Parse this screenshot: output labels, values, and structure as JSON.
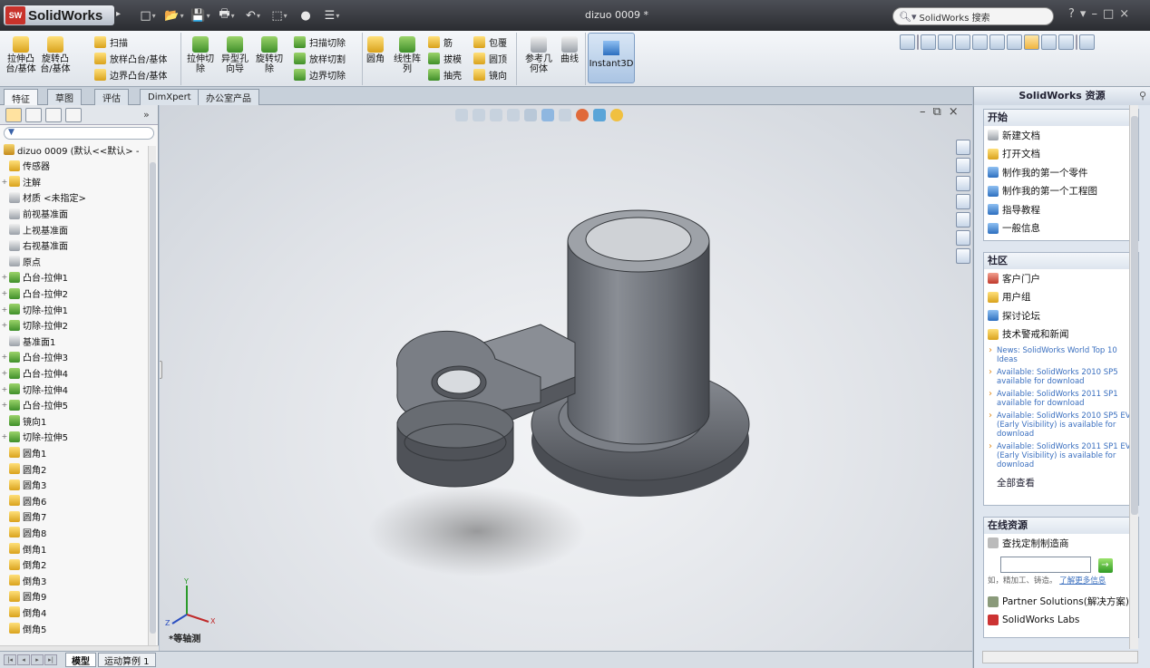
{
  "app": {
    "logo_text": "SolidWorks",
    "logo_badge": "SW",
    "doc_title": "dizuo 0009 *"
  },
  "titlebar": {
    "search_placeholder": "SolidWorks 搜索",
    "help": "?",
    "minimize": "–",
    "maximize": "□",
    "close": "×"
  },
  "ribbon": {
    "extrude_boss": "拉伸凸\n台/基体",
    "revolve_boss": "旋转凸\n台/基体",
    "sweep": "扫描",
    "loft": "放样凸台/基体",
    "boundary_boss": "边界凸台/基体",
    "extrude_cut": "拉伸切\n除",
    "hole_wizard": "异型孔\n向导",
    "revolve_cut": "旋转切\n除",
    "sweep_cut": "扫描切除",
    "loft_cut": "放样切割",
    "boundary_cut": "边界切除",
    "fillet": "圆角",
    "linear_pattern": "线性阵\n列",
    "rib": "筋",
    "draft": "拔模",
    "shell": "抽壳",
    "wrap": "包覆",
    "dome": "圆顶",
    "mirror": "镜向",
    "ref_geometry": "参考几\n何体",
    "curves": "曲线",
    "instant3d": "Instant3D"
  },
  "tabs": [
    "特征",
    "草图",
    "评估",
    "DimXpert",
    "办公室产品"
  ],
  "feature_tree": {
    "root": "dizuo 0009  (默认<<默认> -",
    "items": [
      {
        "label": "传感器",
        "toggle": "",
        "color": "y"
      },
      {
        "label": "注解",
        "toggle": "+",
        "color": "y"
      },
      {
        "label": "材质 <未指定>",
        "toggle": "",
        "color": "gy"
      },
      {
        "label": "前视基准面",
        "toggle": "",
        "color": "gy"
      },
      {
        "label": "上视基准面",
        "toggle": "",
        "color": "gy"
      },
      {
        "label": "右视基准面",
        "toggle": "",
        "color": "gy"
      },
      {
        "label": "原点",
        "toggle": "",
        "color": "gy"
      },
      {
        "label": "凸台-拉伸1",
        "toggle": "+",
        "color": "g"
      },
      {
        "label": "凸台-拉伸2",
        "toggle": "+",
        "color": "g"
      },
      {
        "label": "切除-拉伸1",
        "toggle": "+",
        "color": "g"
      },
      {
        "label": "切除-拉伸2",
        "toggle": "+",
        "color": "g"
      },
      {
        "label": "基准面1",
        "toggle": "",
        "color": "gy"
      },
      {
        "label": "凸台-拉伸3",
        "toggle": "+",
        "color": "g"
      },
      {
        "label": "凸台-拉伸4",
        "toggle": "+",
        "color": "g"
      },
      {
        "label": "切除-拉伸4",
        "toggle": "+",
        "color": "g"
      },
      {
        "label": "凸台-拉伸5",
        "toggle": "+",
        "color": "g"
      },
      {
        "label": "镜向1",
        "toggle": "",
        "color": "g"
      },
      {
        "label": "切除-拉伸5",
        "toggle": "+",
        "color": "g"
      },
      {
        "label": "圆角1",
        "toggle": "",
        "color": "y"
      },
      {
        "label": "圆角2",
        "toggle": "",
        "color": "y"
      },
      {
        "label": "圆角3",
        "toggle": "",
        "color": "y"
      },
      {
        "label": "圆角6",
        "toggle": "",
        "color": "y"
      },
      {
        "label": "圆角7",
        "toggle": "",
        "color": "y"
      },
      {
        "label": "圆角8",
        "toggle": "",
        "color": "y"
      },
      {
        "label": "倒角1",
        "toggle": "",
        "color": "y"
      },
      {
        "label": "倒角2",
        "toggle": "",
        "color": "y"
      },
      {
        "label": "倒角3",
        "toggle": "",
        "color": "y"
      },
      {
        "label": "圆角9",
        "toggle": "",
        "color": "y"
      },
      {
        "label": "倒角4",
        "toggle": "",
        "color": "y"
      },
      {
        "label": "倒角5",
        "toggle": "",
        "color": "y"
      }
    ]
  },
  "viewport": {
    "view_label": "*等轴测",
    "axis_x": "X",
    "axis_y": "Y",
    "axis_z": "Z"
  },
  "bottom_tabs": [
    "模型",
    "运动算例 1"
  ],
  "taskpane": {
    "title": "SolidWorks 资源",
    "start": {
      "header": "开始",
      "items": [
        "新建文档",
        "打开文档",
        "制作我的第一个零件",
        "制作我的第一个工程图",
        "指导教程",
        "一般信息"
      ]
    },
    "community": {
      "header": "社区",
      "items": [
        "客户门户",
        "用户组",
        "探讨论坛",
        "技术警戒和新闻"
      ],
      "news": [
        "News: SolidWorks World Top 10 Ideas",
        "Available: SolidWorks 2010 SP5 available for download",
        "Available: SolidWorks 2011 SP1 available for download",
        "Available: SolidWorks 2010 SP5 EV (Early Visibility) is available for download",
        "Available: SolidWorks 2011 SP1 EV (Early Visibility) is available for download"
      ],
      "view_all": "全部查看"
    },
    "online": {
      "header": "在线资源",
      "find": "查找定制制造商",
      "hint": "如，精加工、铸造。",
      "hint_link": "了解更多信息",
      "partner": "Partner Solutions(解决方案)",
      "labs": "SolidWorks Labs"
    }
  },
  "colors": {
    "accent": "#2d6fbf",
    "part": "#6d7178"
  }
}
